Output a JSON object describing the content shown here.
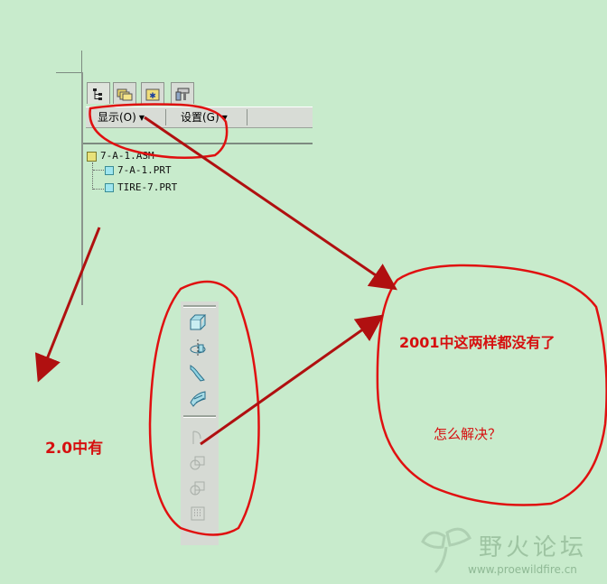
{
  "tree_panel": {
    "tabs": [
      {
        "icon": "model-tree-icon"
      },
      {
        "icon": "folder-browser-icon"
      },
      {
        "icon": "favorites-folder-icon"
      },
      {
        "icon": "connections-icon"
      }
    ],
    "menu": {
      "show_label": "显示(O)",
      "settings_label": "设置(G)"
    },
    "nodes": [
      {
        "label": "7-A-1.ASM",
        "type": "assembly"
      },
      {
        "label": "7-A-1.PRT",
        "type": "part"
      },
      {
        "label": "TIRE-7.PRT",
        "type": "part"
      }
    ]
  },
  "toolbar": {
    "buttons": [
      {
        "icon": "extrude-icon",
        "enabled": true
      },
      {
        "icon": "revolve-icon",
        "enabled": true
      },
      {
        "icon": "sweep-icon",
        "enabled": true
      },
      {
        "icon": "surface-icon",
        "enabled": true
      },
      {
        "icon": "round-icon",
        "enabled": false
      },
      {
        "icon": "chamfer-icon",
        "enabled": false
      },
      {
        "icon": "shell-icon",
        "enabled": false
      },
      {
        "icon": "pattern-icon",
        "enabled": false
      }
    ]
  },
  "annotations": {
    "left_note": "2.0中有",
    "right_note_1": "2001中这两样都没有了",
    "right_note_2": "怎么解决？"
  },
  "watermark": {
    "title": "野火论坛",
    "url": "www.proewildfire.cn"
  },
  "colors": {
    "background": "#c8ebcc",
    "annotation_red": "#d60f0f",
    "arrow_red": "#b01010",
    "panel_gray": "#d8dcd6"
  }
}
